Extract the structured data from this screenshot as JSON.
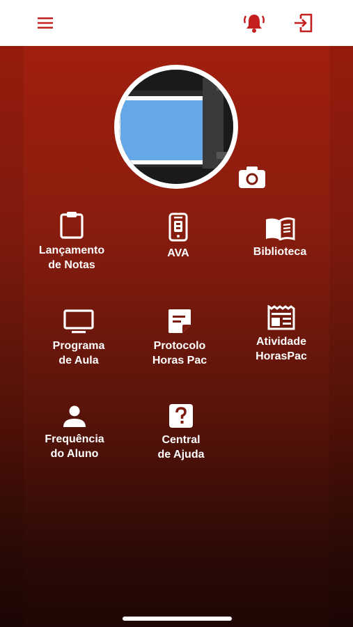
{
  "header": {
    "menu_icon": "hamburger-menu-icon",
    "notification_icon": "alarm-bell-icon",
    "logout_icon": "logout-icon"
  },
  "profile": {
    "avatar_icon": "computer-monitor-image",
    "camera_icon": "camera-icon"
  },
  "tiles": [
    {
      "label": "Lançamento\nde Notas",
      "icon": "clipboard-icon"
    },
    {
      "label": "AVA",
      "icon": "mobile-phone-icon"
    },
    {
      "label": "Biblioteca",
      "icon": "open-book-icon"
    },
    {
      "label": "Programa\nde Aula",
      "icon": "monitor-icon"
    },
    {
      "label": "Protocolo\nHoras Pac",
      "icon": "sticky-note-icon"
    },
    {
      "label": "Atividade\nHorasPac",
      "icon": "receipt-icon"
    },
    {
      "label": "Frequência\ndo Aluno",
      "icon": "person-icon"
    },
    {
      "label": "Central\nde Ajuda",
      "icon": "help-question-icon"
    }
  ],
  "colors": {
    "accent": "#c41f1f",
    "background_top": "#a11f0f",
    "background_bottom": "#1e0704",
    "avatar_ring": "#1ea3c4"
  }
}
